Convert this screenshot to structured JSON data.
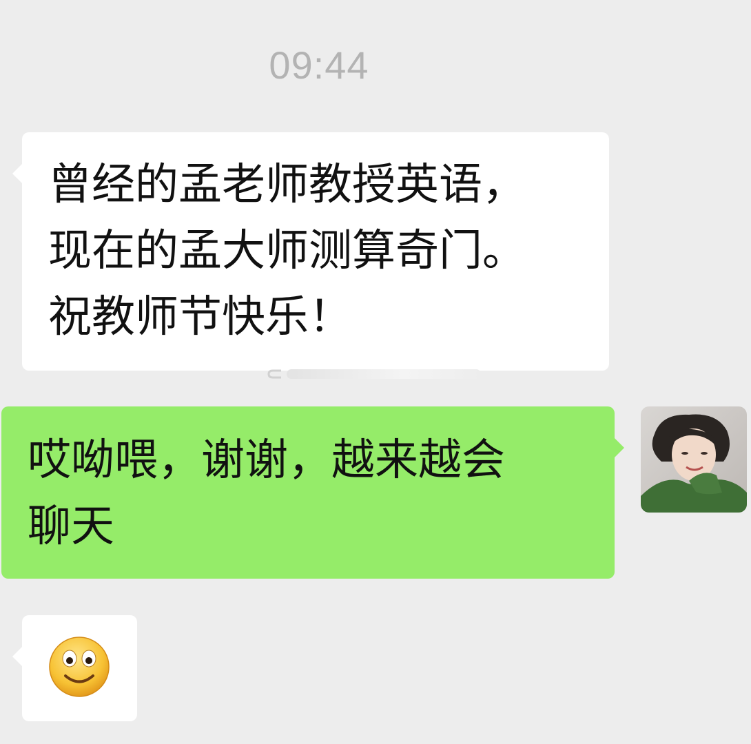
{
  "chat": {
    "timestamp": "09:44",
    "messages": [
      {
        "side": "incoming",
        "lines": [
          "曾经的孟老师教授英语，",
          "现在的孟大师测算奇门。",
          "祝教师节快乐！"
        ]
      },
      {
        "side": "outgoing",
        "lines": [
          "哎呦喂，谢谢，越来越会",
          "聊天"
        ]
      },
      {
        "side": "incoming",
        "emoji": "smile-emoji-icon"
      }
    ]
  },
  "colors": {
    "background": "#ededed",
    "incoming_bubble": "#ffffff",
    "outgoing_bubble": "#95ec69",
    "timestamp_text": "#b3b3b3"
  }
}
